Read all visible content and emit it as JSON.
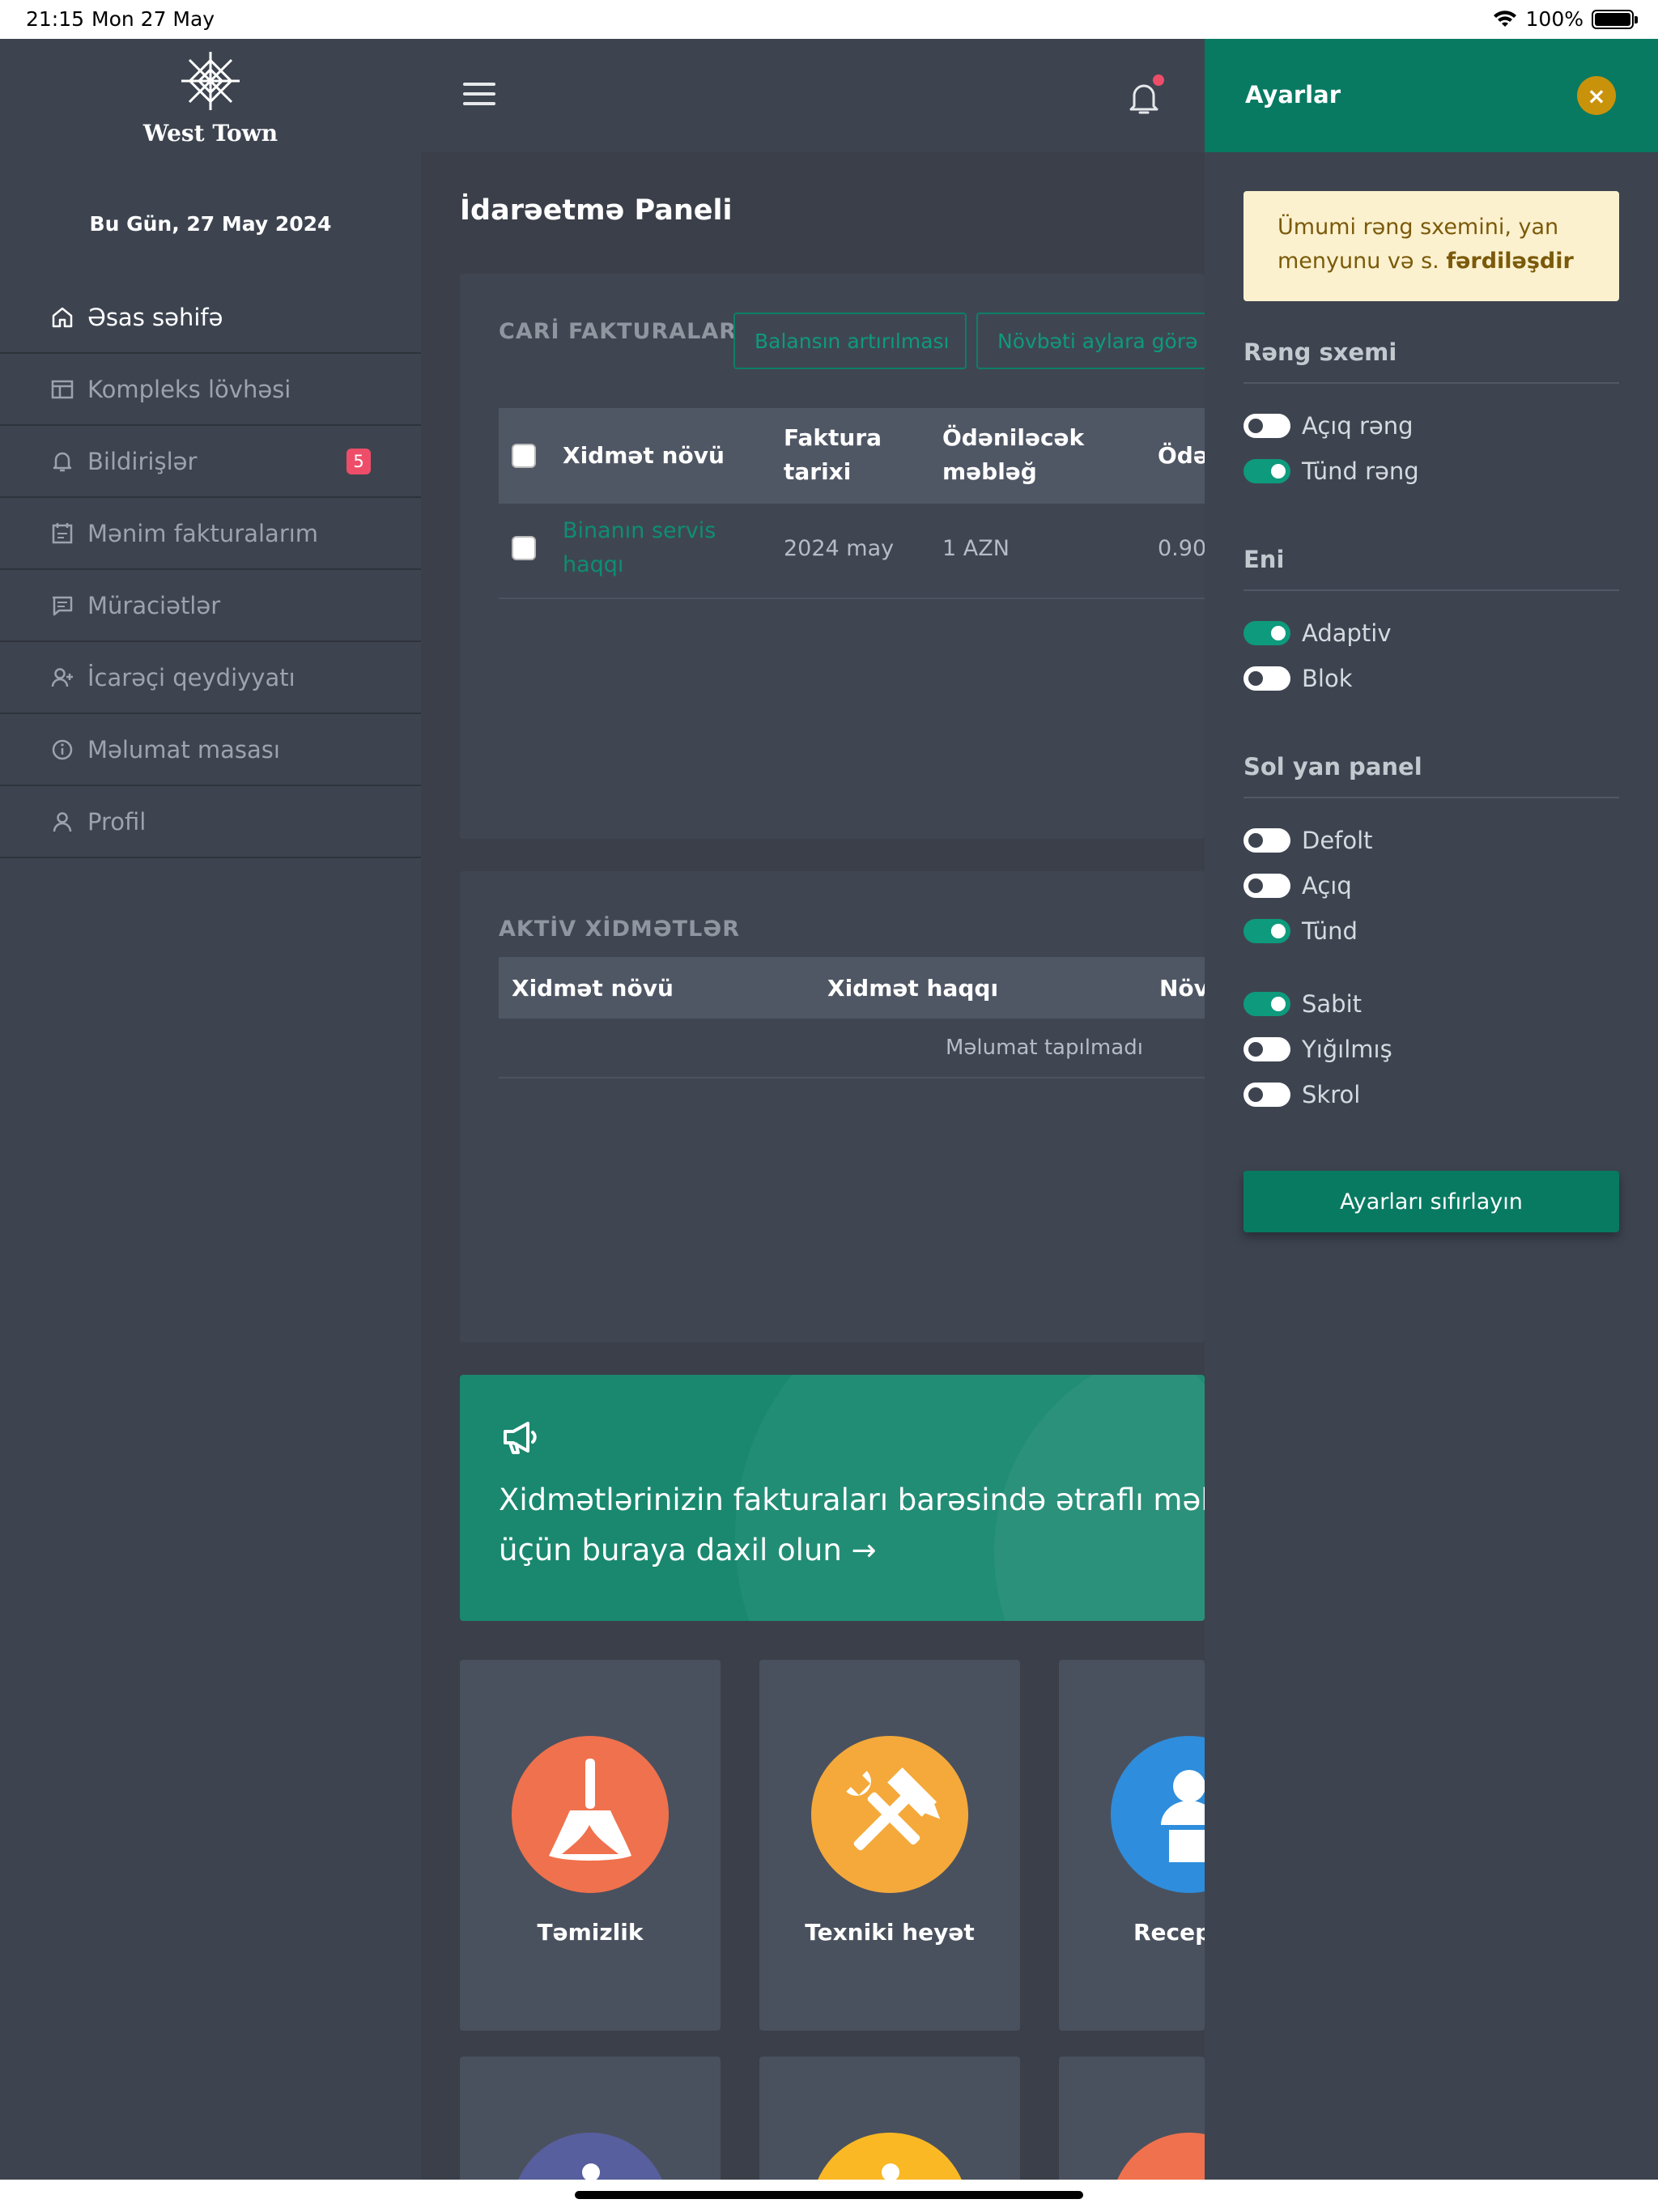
{
  "status_bar": {
    "time": "21:15",
    "date": "Mon 27 May",
    "battery": "100%"
  },
  "brand": {
    "name": "West Town"
  },
  "sidebar": {
    "today": "Bu Gün, 27 May 2024",
    "items": [
      {
        "label": "Əsas səhifə",
        "icon": "home-icon"
      },
      {
        "label": "Kompleks lövhəsi",
        "icon": "board-icon"
      },
      {
        "label": "Bildirişlər",
        "icon": "bell-icon",
        "badge": "5"
      },
      {
        "label": "Mənim fakturalarım",
        "icon": "invoice-icon"
      },
      {
        "label": "Müraciətlər",
        "icon": "message-icon"
      },
      {
        "label": "İcarəçi qeydiyyatı",
        "icon": "user-add-icon"
      },
      {
        "label": "Məlumat masası",
        "icon": "info-icon"
      },
      {
        "label": "Profil",
        "icon": "user-icon"
      }
    ]
  },
  "main": {
    "title": "İdarəetmə Paneli",
    "invoices": {
      "title": "CARİ FAKTURALAR",
      "buttons": [
        "Balansın artırılması",
        "Növbəti aylara görə ödəniş"
      ],
      "headers": [
        "Xidmət növü",
        "Faktura tarixi",
        "Ödəniləcək məbləğ",
        "Ödəniş"
      ],
      "header_lines": {
        "date_1": "Faktura",
        "date_2": "tarixi",
        "amount_1": "Ödəniləcək",
        "amount_2": "məbləğ"
      },
      "rows": [
        {
          "service_1": "Binanın servis",
          "service_2": "haqqı",
          "date": "2024 may",
          "amount": "1 AZN",
          "paid": "0.90"
        }
      ]
    },
    "active_services": {
      "title": "AKTİV XİDMƏTLƏR",
      "headers": [
        "Xidmət növü",
        "Xidmət haqqı",
        "Növü"
      ],
      "empty": "Məlumat tapılmadı"
    },
    "banner": {
      "icon": "megaphone-icon",
      "line1": "Xidmətlərinizin fakturaları barəsində ətraflı məlumat",
      "line2": "üçün buraya daxil olun →"
    },
    "services": [
      {
        "label": "Təmizlik",
        "icon": "broom-icon",
        "color": "#f0714d"
      },
      {
        "label": "Texniki heyət",
        "icon": "tools-icon",
        "color": "#f4a93a"
      },
      {
        "label": "Resepşn",
        "icon": "receptionist-icon",
        "color": "#2e8ddc"
      }
    ]
  },
  "settings": {
    "title": "Ayarlar",
    "close_symbol": "×",
    "hint_text": "Ümumi rəng sxemini, yan menyunu və s. ",
    "hint_bold": "fərdiləşdir",
    "sections": [
      {
        "title": "Rəng sxemi",
        "options": [
          {
            "label": "Açıq rəng",
            "on": false
          },
          {
            "label": "Tünd rəng",
            "on": true
          }
        ]
      },
      {
        "title": "Eni",
        "options": [
          {
            "label": "Adaptiv",
            "on": true
          },
          {
            "label": "Blok",
            "on": false
          }
        ]
      },
      {
        "title": "Sol yan panel",
        "options": [
          {
            "label": "Defolt",
            "on": false
          },
          {
            "label": "Açıq",
            "on": false
          },
          {
            "label": "Tünd",
            "on": true
          }
        ]
      }
    ],
    "position_options": [
      {
        "label": "Sabit",
        "on": true
      },
      {
        "label": "Yığılmış",
        "on": false
      },
      {
        "label": "Skrol",
        "on": false
      }
    ],
    "reset_label": "Ayarları sıfırlayın"
  },
  "colors": {
    "accent": "#087a62",
    "sidebar_bg": "#3d4450",
    "content_bg": "#3a3f49",
    "badge": "#ee4d69",
    "close": "#c9920b"
  }
}
